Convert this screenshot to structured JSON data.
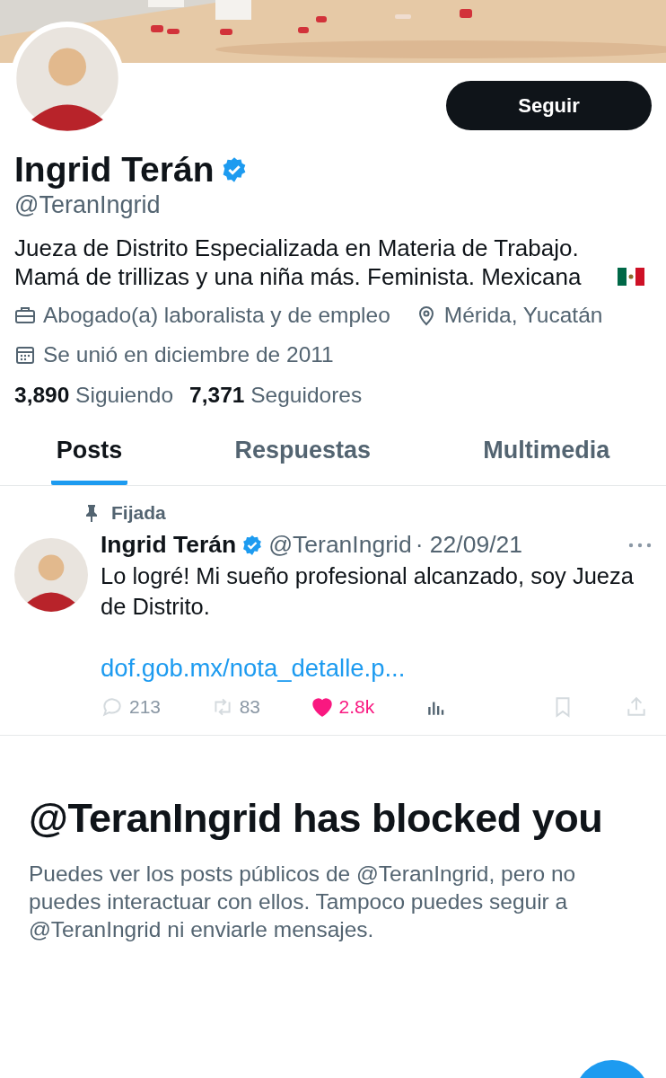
{
  "profile": {
    "follow_button": "Seguir",
    "name": "Ingrid Terán",
    "verified": true,
    "handle": "@TeranIngrid",
    "bio": "Jueza de Distrito Especializada en Materia de Trabajo. Mamá de trillizas y una niña más. Feminista. Mexicana",
    "category": "Abogado(a) laboralista y de empleo",
    "location": "Mérida, Yucatán",
    "joined": "Se unió en diciembre de 2011",
    "stats": [
      {
        "count": "3,890",
        "label": "Siguiendo"
      },
      {
        "count": "7,371",
        "label": "Seguidores"
      }
    ]
  },
  "tabs": [
    {
      "label": "Posts",
      "selected": true
    },
    {
      "label": "Respuestas",
      "selected": false
    },
    {
      "label": "Multimedia",
      "selected": false
    }
  ],
  "pinned_post": {
    "pinned_label": "Fijada",
    "author": "Ingrid Terán",
    "verified": true,
    "handle": "@TeranIngrid",
    "date": "· 22/09/21",
    "text": "Lo logré! Mi sueño profesional alcanzado, soy Jueza de Distrito.",
    "link": "dof.gob.mx/nota_detalle.p...",
    "actions": [
      {
        "kind": "reply",
        "count": "213"
      },
      {
        "kind": "repost",
        "count": "83"
      },
      {
        "kind": "like",
        "count": "2.8k",
        "liked": true
      },
      {
        "kind": "views"
      },
      {
        "kind": "bookmark"
      },
      {
        "kind": "share"
      }
    ]
  },
  "blocked_notice": {
    "title": "@TeranIngrid has blocked you",
    "text": "Puedes ver los posts públicos de @TeranIngrid, pero no puedes interactuar con ellos. Tampoco puedes seguir a @TeranIngrid ni enviarle mensajes."
  }
}
